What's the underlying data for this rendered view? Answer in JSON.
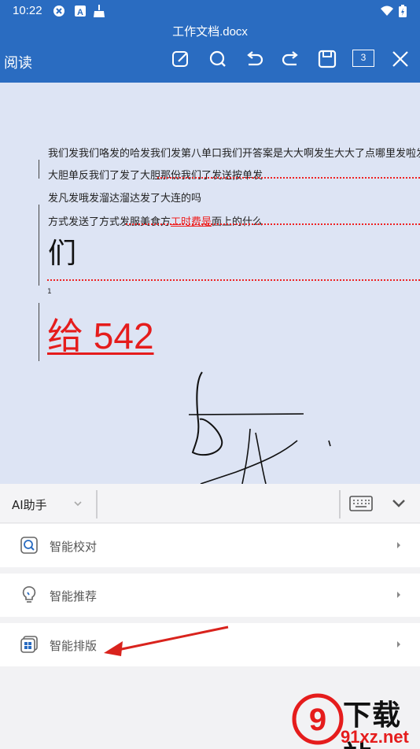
{
  "status_bar": {
    "time": "10:22"
  },
  "header": {
    "doc_title": "工作文档.docx",
    "mode_label": "阅读",
    "page_count": "3"
  },
  "document": {
    "lines": [
      "我们发我们咯发的哈发我们发第八单口我们开答案是大大啊发生大大了点哪里发啦发",
      "大胆单反我们了发了大胆那份我们了发送按单发",
      "发凡发哦发溜达溜达发了大连的吗",
      "方式发送了方式发服美食方"
    ],
    "line4_red": "工时费是",
    "line4_tail": "面上的什么",
    "big_char": "们",
    "small_mark": "1",
    "big_red_text": "给 542"
  },
  "ai_panel": {
    "label": "AI助手",
    "items": [
      {
        "label": "智能校对",
        "icon": "proofread-icon"
      },
      {
        "label": "智能推荐",
        "icon": "lightbulb-icon"
      },
      {
        "label": "智能排版",
        "icon": "layout-icon"
      }
    ]
  },
  "watermark": {
    "brand": "下载站",
    "url": "91xz.net"
  },
  "colors": {
    "header_bg": "#2a6cc1",
    "doc_bg": "#dde4f4",
    "revision_red": "#e51c1c"
  }
}
